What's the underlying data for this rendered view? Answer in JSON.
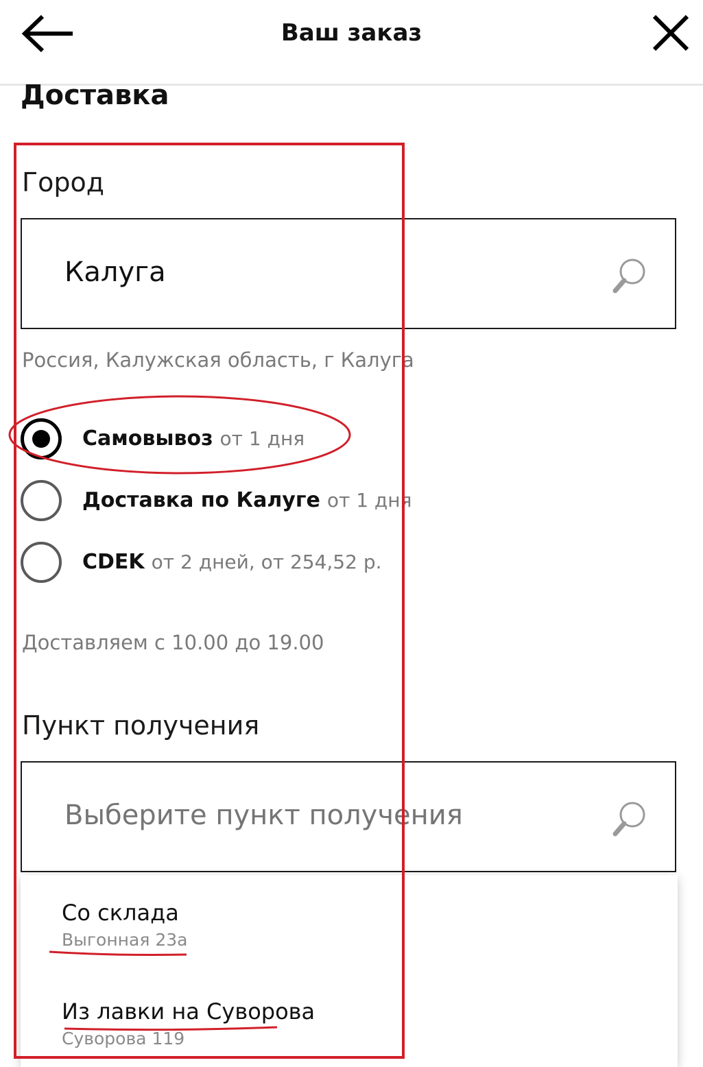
{
  "header": {
    "title": "Ваш заказ"
  },
  "section_title": "Доставка",
  "city": {
    "label": "Город",
    "value": "Калуга",
    "hint": "Россия, Калужская область, г Калуга"
  },
  "delivery_options": [
    {
      "name": "Самовывоз",
      "note": "от 1 дня",
      "checked": true
    },
    {
      "name": "Доставка по Калуге",
      "note": "от 1 дня",
      "checked": false
    },
    {
      "name": "CDEK",
      "note": "от 2 дней, от 254,52 р.",
      "checked": false
    }
  ],
  "schedule_text": "Доставляем с 10.00 до 19.00",
  "pickup": {
    "label": "Пункт получения",
    "placeholder": "Выберите пункт получения",
    "options": [
      {
        "name": "Со склада",
        "address": "Выгонная 23а"
      },
      {
        "name": "Из лавки на Суворова",
        "address": "Суворова 119"
      }
    ]
  },
  "colors": {
    "annotation": "#d11f2a",
    "text": "#111111",
    "muted": "#7a7a7a"
  }
}
